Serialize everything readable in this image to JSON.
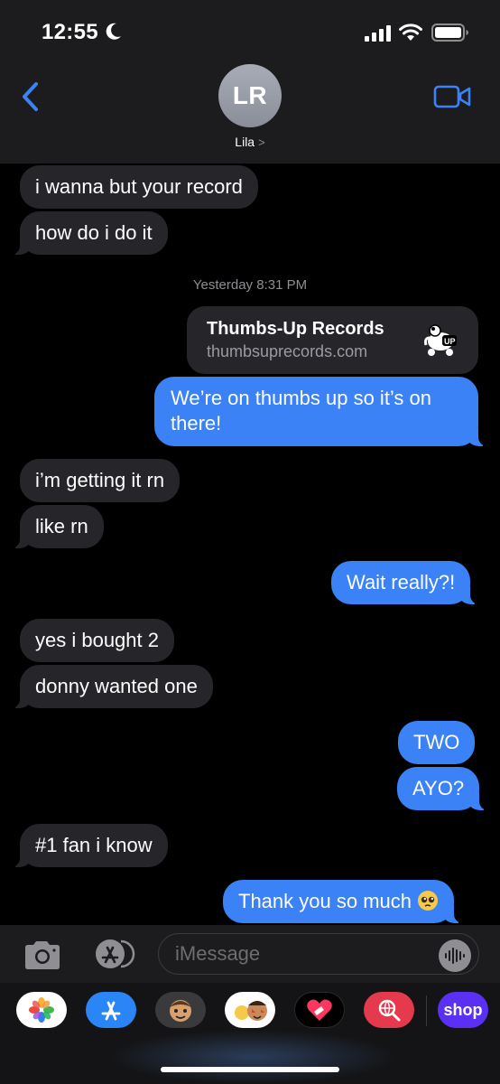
{
  "status_bar": {
    "time": "12:55",
    "focus_icon": "moon-icon",
    "icons": [
      "cellular-signal-icon",
      "wifi-icon",
      "battery-icon"
    ]
  },
  "header": {
    "avatar_initials": "LR",
    "contact_name": "Lila",
    "contact_chevron": ">",
    "back_icon": "chevron-left-icon",
    "video_icon": "video-camera-icon"
  },
  "colors": {
    "accent": "#3b82f6",
    "incoming_bubble": "#26252a",
    "background": "#000000",
    "header_bg": "#1c1c1e"
  },
  "messages": [
    {
      "from": "them",
      "text": "i wanna but your record"
    },
    {
      "from": "them",
      "text": "how do i do it"
    },
    {
      "type": "timestamp",
      "day": "Yesterday",
      "time": "8:31 PM"
    },
    {
      "from": "me",
      "type": "link",
      "title": "Thumbs-Up Records",
      "url": "thumbsuprecords.com"
    },
    {
      "from": "me",
      "text": "We’re on thumbs up so it’s on",
      "text2": "there!"
    },
    {
      "from": "them",
      "text": "i’m getting it rn"
    },
    {
      "from": "them",
      "text": "like rn"
    },
    {
      "from": "me",
      "text": "Wait really?!"
    },
    {
      "from": "them",
      "text": "yes i bought 2"
    },
    {
      "from": "them",
      "text": "donny wanted one"
    },
    {
      "from": "me",
      "text": "TWO"
    },
    {
      "from": "me",
      "text": "AYO?"
    },
    {
      "from": "them",
      "text": "#1 fan i know"
    },
    {
      "from": "me",
      "text": "Thank you so much",
      "emoji": "pleading-face-emoji"
    }
  ],
  "input_bar": {
    "placeholder": "iMessage",
    "camera_icon": "camera-icon",
    "apps_icon": "app-store-icon",
    "audio_icon": "audio-waveform-icon"
  },
  "app_drawer": {
    "apps": [
      "photos",
      "app-store",
      "memoji",
      "animoji-stickers",
      "digital-touch",
      "images-search"
    ],
    "shop_label": "shop"
  }
}
